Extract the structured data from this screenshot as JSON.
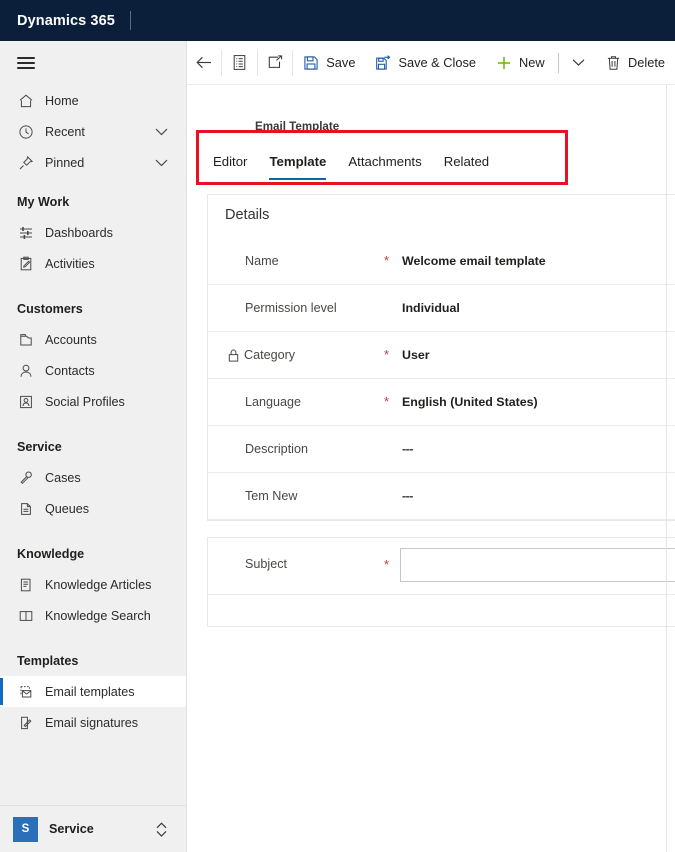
{
  "brand": {
    "title": "Dynamics 365"
  },
  "sidebar": {
    "hamburger_name": "site-map-toggle",
    "top_items": [
      {
        "label": "Home",
        "icon": "home-icon",
        "chevron": false
      },
      {
        "label": "Recent",
        "icon": "clock-icon",
        "chevron": true
      },
      {
        "label": "Pinned",
        "icon": "pin-icon",
        "chevron": true
      }
    ],
    "groups": [
      {
        "title": "My Work",
        "items": [
          {
            "label": "Dashboards",
            "icon": "dashboard-icon"
          },
          {
            "label": "Activities",
            "icon": "activities-icon"
          }
        ]
      },
      {
        "title": "Customers",
        "items": [
          {
            "label": "Accounts",
            "icon": "account-icon"
          },
          {
            "label": "Contacts",
            "icon": "contact-icon"
          },
          {
            "label": "Social Profiles",
            "icon": "social-profile-icon"
          }
        ]
      },
      {
        "title": "Service",
        "items": [
          {
            "label": "Cases",
            "icon": "case-icon"
          },
          {
            "label": "Queues",
            "icon": "queue-icon"
          }
        ]
      },
      {
        "title": "Knowledge",
        "items": [
          {
            "label": "Knowledge Articles",
            "icon": "knowledge-article-icon"
          },
          {
            "label": "Knowledge Search",
            "icon": "knowledge-search-icon"
          }
        ]
      },
      {
        "title": "Templates",
        "items": [
          {
            "label": "Email templates",
            "icon": "email-template-icon",
            "selected": true
          },
          {
            "label": "Email signatures",
            "icon": "email-signature-icon",
            "selected": false
          }
        ]
      }
    ],
    "footer": {
      "badge": "S",
      "app_name": "Service"
    }
  },
  "commandbar": {
    "back_name": "back-arrow-icon",
    "form_selector_name": "form-selector-icon",
    "popout_name": "open-in-new-window-icon",
    "buttons": [
      {
        "label": "Save",
        "icon": "save-icon"
      },
      {
        "label": "Save & Close",
        "icon": "save-and-close-icon"
      },
      {
        "label": "New",
        "icon": "plus-icon"
      },
      {
        "label": "Delete",
        "icon": "trash-icon"
      }
    ],
    "overflow_name": "chevron-down-icon"
  },
  "form": {
    "entity_label": "Email Template",
    "tabs": [
      {
        "label": "Editor",
        "active": false
      },
      {
        "label": "Template",
        "active": true
      },
      {
        "label": "Attachments",
        "active": false
      },
      {
        "label": "Related",
        "active": false
      }
    ],
    "details": {
      "title": "Details",
      "fields": [
        {
          "label": "Name",
          "required": true,
          "locked": false,
          "value": "Welcome email template"
        },
        {
          "label": "Permission level",
          "required": false,
          "locked": false,
          "value": "Individual"
        },
        {
          "label": "Category",
          "required": true,
          "locked": true,
          "value": "User"
        },
        {
          "label": "Language",
          "required": true,
          "locked": false,
          "value": "English (United States)"
        },
        {
          "label": "Description",
          "required": false,
          "locked": false,
          "value": "---"
        },
        {
          "label": "Tem New",
          "required": false,
          "locked": false,
          "value": "---"
        }
      ]
    },
    "subject": {
      "label": "Subject",
      "required": true,
      "value": "",
      "placeholder": ""
    }
  },
  "annotation": {
    "highlight_color": "#e81123",
    "target_name": "tabstrip-highlight"
  },
  "colors": {
    "brand_bar": "#0b1f3a",
    "accent": "#1264a3",
    "selected_indicator": "#0f6cbd",
    "required_marker": "#d13438",
    "new_icon_green": "#6bb700",
    "app_badge": "#2a6fb8"
  }
}
